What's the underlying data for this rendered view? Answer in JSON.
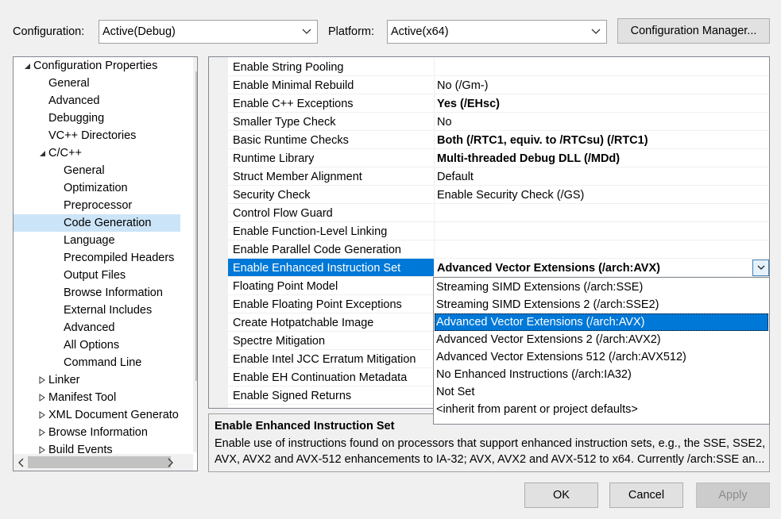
{
  "header": {
    "config_label": "Configuration:",
    "config_value": "Active(Debug)",
    "platform_label": "Platform:",
    "platform_value": "Active(x64)",
    "config_manager_label": "Configuration Manager..."
  },
  "tree": {
    "items": [
      {
        "label": "Configuration Properties",
        "level": 0,
        "toggle": "expanded"
      },
      {
        "label": "General",
        "level": 1
      },
      {
        "label": "Advanced",
        "level": 1
      },
      {
        "label": "Debugging",
        "level": 1
      },
      {
        "label": "VC++ Directories",
        "level": 1
      },
      {
        "label": "C/C++",
        "level": 1,
        "toggle": "expanded"
      },
      {
        "label": "General",
        "level": 2
      },
      {
        "label": "Optimization",
        "level": 2
      },
      {
        "label": "Preprocessor",
        "level": 2
      },
      {
        "label": "Code Generation",
        "level": 2,
        "selected": true
      },
      {
        "label": "Language",
        "level": 2
      },
      {
        "label": "Precompiled Headers",
        "level": 2
      },
      {
        "label": "Output Files",
        "level": 2
      },
      {
        "label": "Browse Information",
        "level": 2
      },
      {
        "label": "External Includes",
        "level": 2
      },
      {
        "label": "Advanced",
        "level": 2
      },
      {
        "label": "All Options",
        "level": 2
      },
      {
        "label": "Command Line",
        "level": 2
      },
      {
        "label": "Linker",
        "level": 1,
        "toggle": "collapsed"
      },
      {
        "label": "Manifest Tool",
        "level": 1,
        "toggle": "collapsed"
      },
      {
        "label": "XML Document Generato",
        "level": 1,
        "toggle": "collapsed"
      },
      {
        "label": "Browse Information",
        "level": 1,
        "toggle": "collapsed"
      },
      {
        "label": "Build Events",
        "level": 1,
        "toggle": "collapsed"
      }
    ]
  },
  "grid": {
    "rows": [
      {
        "name": "Enable String Pooling",
        "value": ""
      },
      {
        "name": "Enable Minimal Rebuild",
        "value": "No (/Gm-)"
      },
      {
        "name": "Enable C++ Exceptions",
        "value": "Yes (/EHsc)",
        "bold": true
      },
      {
        "name": "Smaller Type Check",
        "value": "No"
      },
      {
        "name": "Basic Runtime Checks",
        "value": "Both (/RTC1, equiv. to /RTCsu) (/RTC1)",
        "bold": true
      },
      {
        "name": "Runtime Library",
        "value": "Multi-threaded Debug DLL (/MDd)",
        "bold": true
      },
      {
        "name": "Struct Member Alignment",
        "value": "Default"
      },
      {
        "name": "Security Check",
        "value": "Enable Security Check (/GS)"
      },
      {
        "name": "Control Flow Guard",
        "value": ""
      },
      {
        "name": "Enable Function-Level Linking",
        "value": ""
      },
      {
        "name": "Enable Parallel Code Generation",
        "value": ""
      },
      {
        "name": "Enable Enhanced Instruction Set",
        "value": "Advanced Vector Extensions (/arch:AVX)",
        "bold": true,
        "selected": true
      },
      {
        "name": "Floating Point Model",
        "value": ""
      },
      {
        "name": "Enable Floating Point Exceptions",
        "value": ""
      },
      {
        "name": "Create Hotpatchable Image",
        "value": ""
      },
      {
        "name": "Spectre Mitigation",
        "value": ""
      },
      {
        "name": "Enable Intel JCC Erratum Mitigation",
        "value": ""
      },
      {
        "name": "Enable EH Continuation Metadata",
        "value": ""
      },
      {
        "name": "Enable Signed Returns",
        "value": ""
      }
    ]
  },
  "dropdown": {
    "options": [
      {
        "label": "Streaming SIMD Extensions (/arch:SSE)"
      },
      {
        "label": "Streaming SIMD Extensions 2 (/arch:SSE2)"
      },
      {
        "label": "Advanced Vector Extensions (/arch:AVX)",
        "selected": true
      },
      {
        "label": "Advanced Vector Extensions 2 (/arch:AVX2)"
      },
      {
        "label": "Advanced Vector Extensions 512 (/arch:AVX512)"
      },
      {
        "label": "No Enhanced Instructions (/arch:IA32)"
      },
      {
        "label": "Not Set"
      },
      {
        "label": "<inherit from parent or project defaults>"
      }
    ]
  },
  "description": {
    "title": "Enable Enhanced Instruction Set",
    "line1": "Enable use of instructions found on processors that support enhanced instruction sets, e.g., the SSE, SSE2,",
    "line2": "AVX, AVX2 and AVX-512 enhancements to IA-32; AVX, AVX2 and AVX-512 to x64. Currently /arch:SSE an..."
  },
  "footer": {
    "ok_label": "OK",
    "cancel_label": "Cancel",
    "apply_label": "Apply"
  },
  "colors": {
    "selection": "#0078d7",
    "tree_selection": "#cce4f7"
  }
}
